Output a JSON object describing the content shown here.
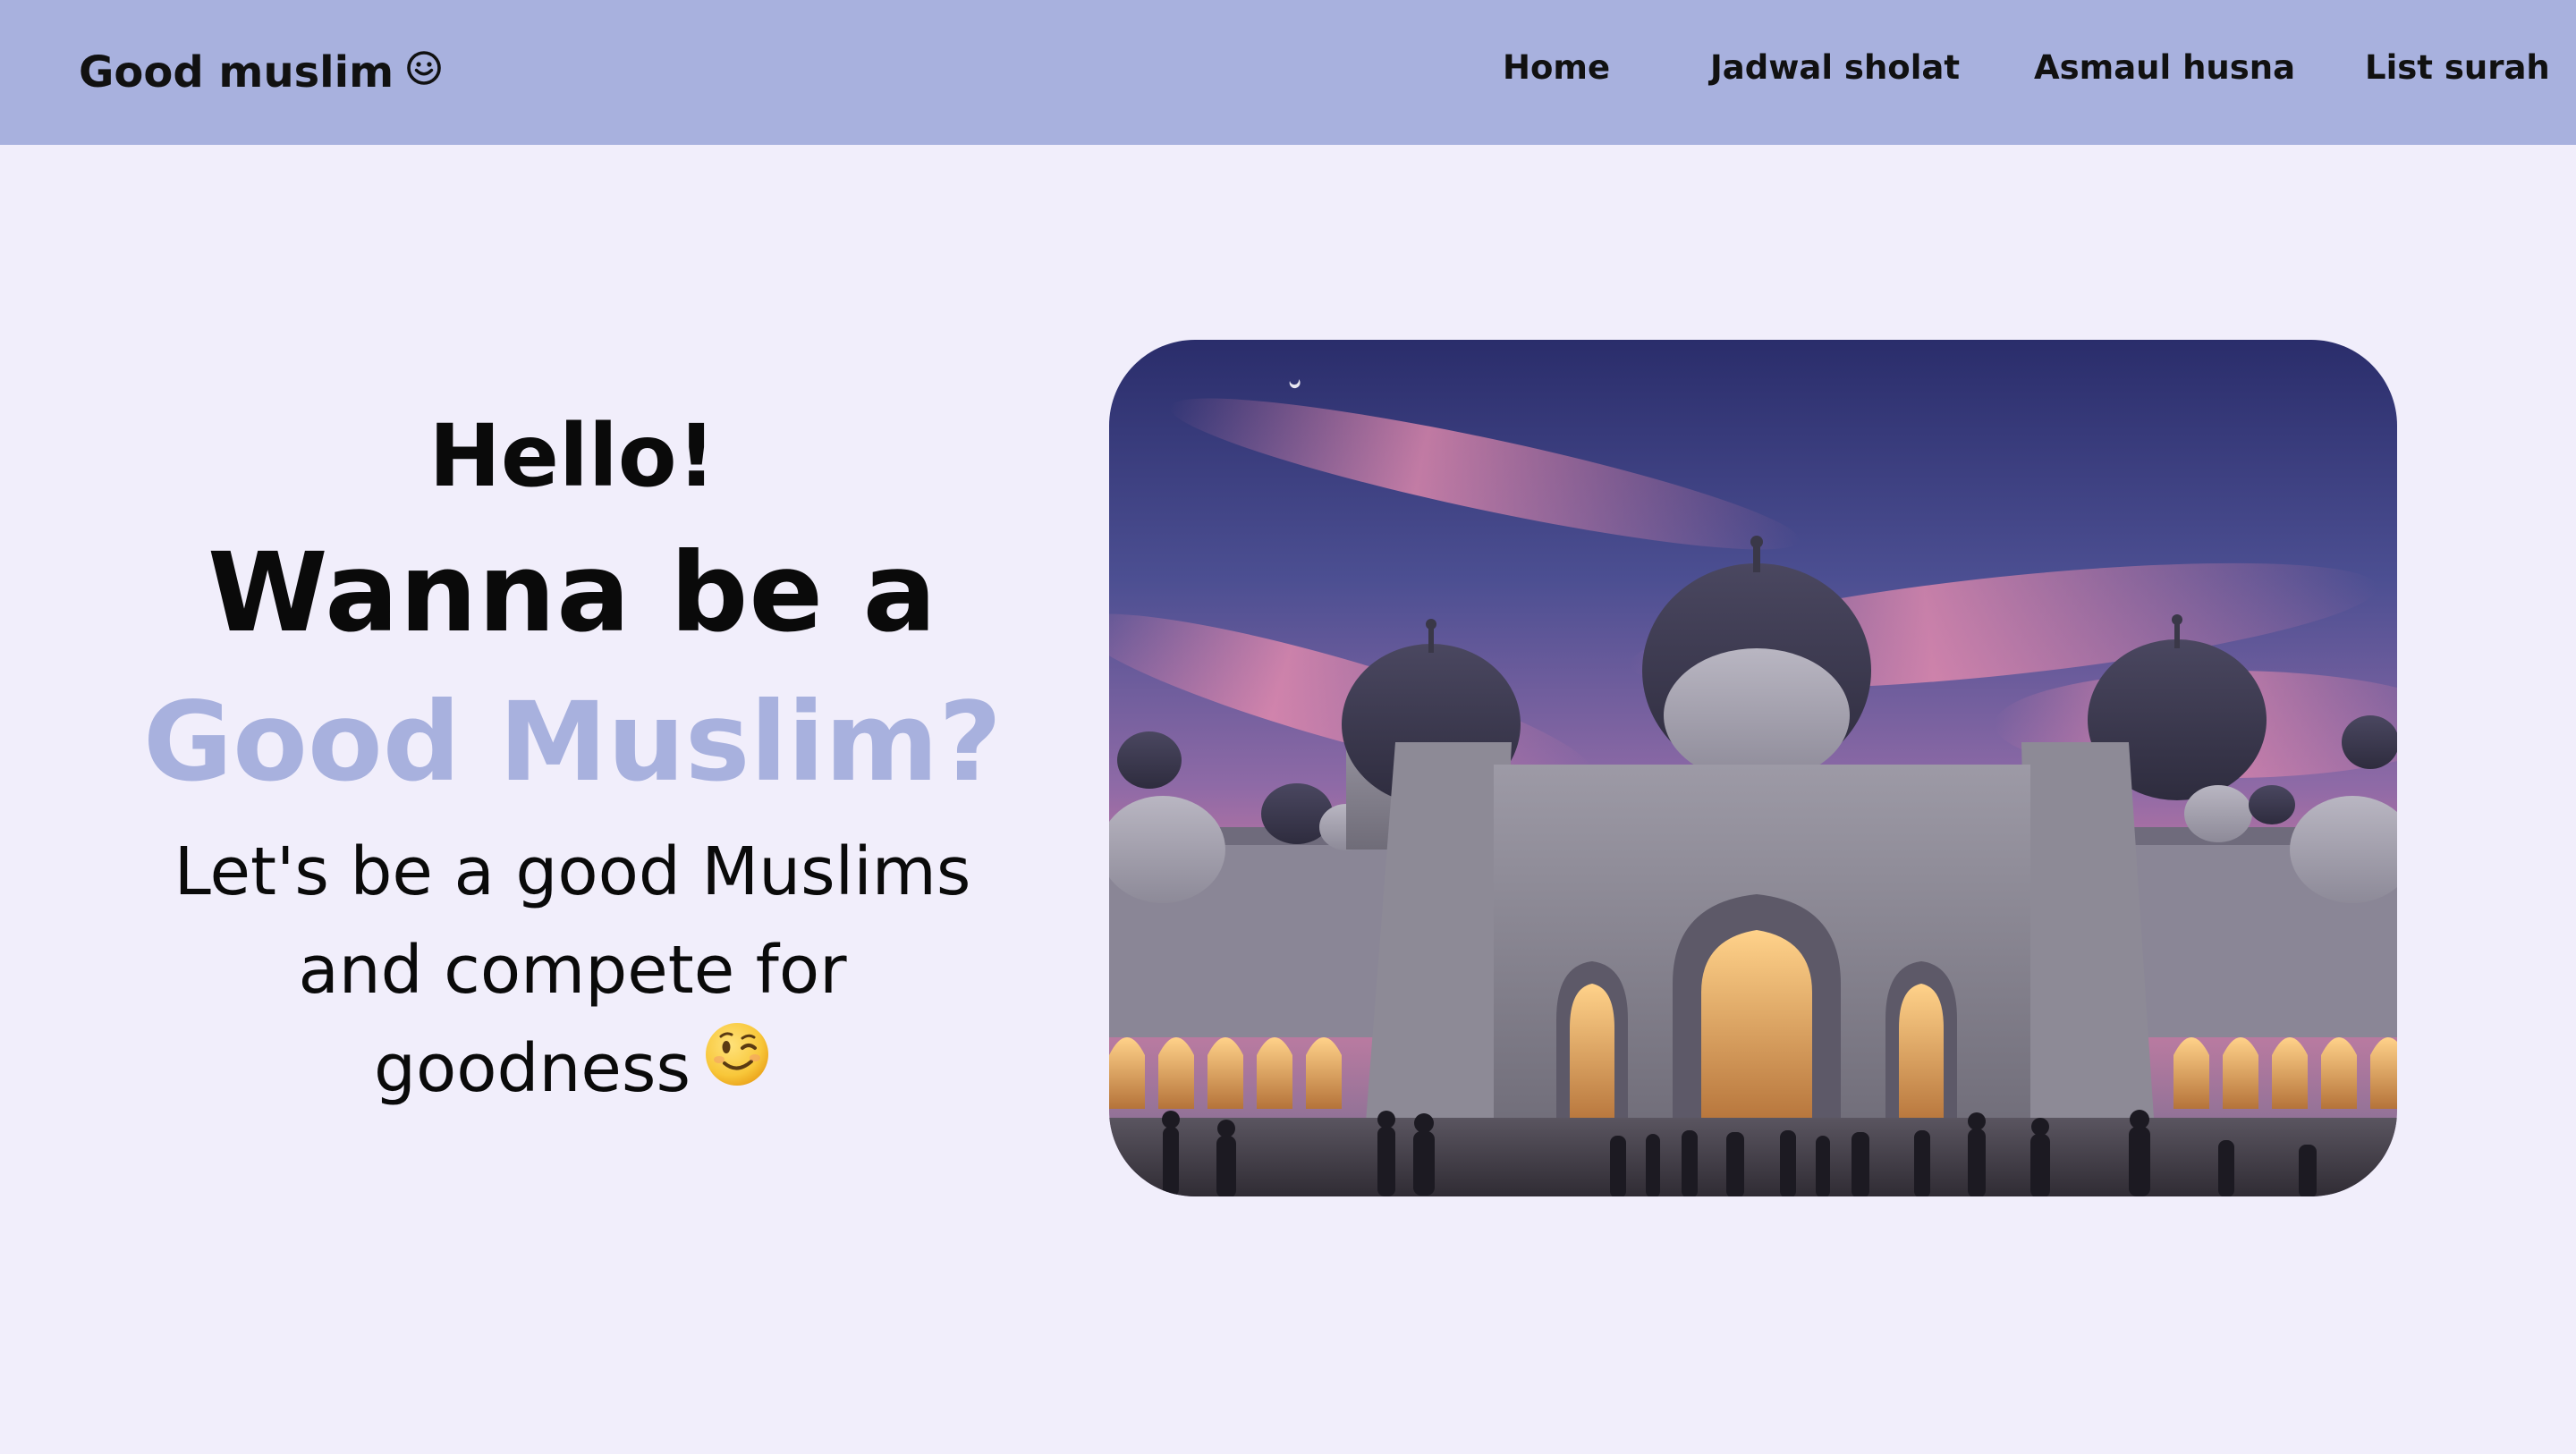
{
  "navbar": {
    "brand": "Good muslim",
    "brand_icon": "smiley-icon",
    "links": [
      {
        "label": "Home"
      },
      {
        "label": "Jadwal sholat"
      },
      {
        "label": "Asmaul husna"
      },
      {
        "label": "List surah"
      }
    ],
    "background": "#a8b1de"
  },
  "hero": {
    "greeting": "Hello!",
    "headline_line1": "Wanna be a",
    "headline_highlight": "Good Muslim?",
    "tagline_line1": "Let's be a good Muslims",
    "tagline_line2": "and compete for",
    "tagline_line3": "goodness",
    "tagline_icon": "winking-face-icon",
    "highlight_color": "#a8b1de"
  },
  "image": {
    "subject": "mosque-photo"
  },
  "colors": {
    "page_background": "#f1eefb",
    "text": "#0a0a0a"
  }
}
